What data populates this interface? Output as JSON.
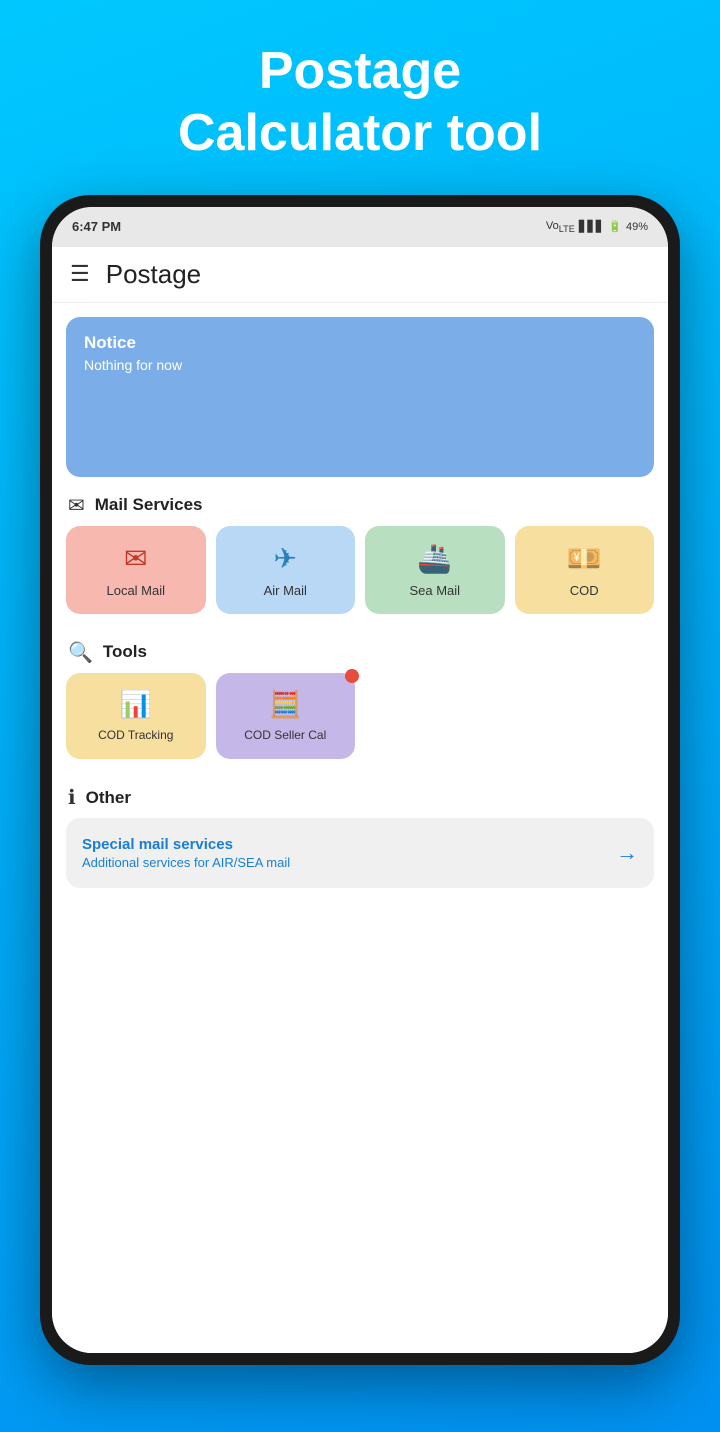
{
  "hero": {
    "title_line1": "Postage",
    "title_line2": "Calculator tool"
  },
  "status_bar": {
    "time": "6:47 PM",
    "battery": "49%"
  },
  "nav": {
    "title": "Postage"
  },
  "notice": {
    "title": "Notice",
    "body": "Nothing for now"
  },
  "mail_services": {
    "section_label": "Mail Services",
    "items": [
      {
        "id": "local-mail",
        "label": "Local Mail"
      },
      {
        "id": "air-mail",
        "label": "Air Mail"
      },
      {
        "id": "sea-mail",
        "label": "Sea Mail"
      },
      {
        "id": "cod",
        "label": "COD"
      }
    ]
  },
  "tools": {
    "section_label": "Tools",
    "items": [
      {
        "id": "cod-tracking",
        "label": "COD Tracking"
      },
      {
        "id": "cod-seller",
        "label": "COD Seller Cal"
      }
    ]
  },
  "other": {
    "section_label": "Other",
    "card_title": "Special mail services",
    "card_sub": "Additional services for AIR/SEA mail"
  }
}
